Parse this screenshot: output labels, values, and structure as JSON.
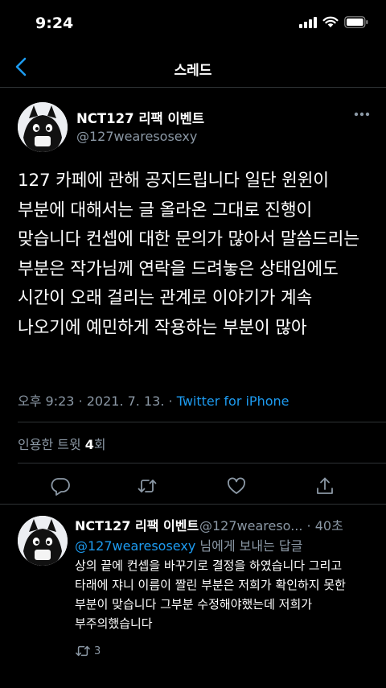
{
  "status": {
    "time": "9:24"
  },
  "nav": {
    "title": "스레드"
  },
  "tweet": {
    "name": "NCT127 리팩 이벤트",
    "handle": "@127wearesosexy",
    "text": "127 카페에 관해 공지드립니다 일단 윈윈이 부분에 대해서는 글 올라온 그대로 진행이 맞습니다 컨셉에 대한 문의가 많아서 말씀드리는 부분은 작가님께 연락을 드려놓은 상태임에도 시간이 오래 걸리는 관계로 이야기가 계속 나오기에 예민하게 작용하는 부분이 많아",
    "time": "오후 9:23",
    "date": "2021. 7. 13.",
    "source": "Twitter for iPhone",
    "quote_label": "인용한 트윗",
    "quote_count": "4",
    "quote_unit": "회"
  },
  "reply": {
    "name": "NCT127 리팩 이벤트",
    "handle": "@127wearesosexy",
    "handle_shown": "@127weareso...",
    "age": "40초",
    "to_handle": "@127wearesosexy",
    "to_suffix": " 님에게 보내는 답글",
    "text": "상의 끝에 컨셉을 바꾸기로 결정을 하였습니다 그리고 타래에 쟈니 이름이 짤린 부분은 저희가 확인하지 못한 부분이 맞습니다 그부분 수정해야했는데 저희가 부주의했습니다",
    "retweet_count": "3"
  },
  "icons": {
    "back": "chevron-left-icon",
    "more": "more-horizontal-icon",
    "reply": "reply-icon",
    "retweet": "retweet-icon",
    "like": "heart-icon",
    "share": "share-icon"
  },
  "colors": {
    "accent": "#1d9bf0",
    "secondary_text": "#8b98a5",
    "divider": "#2f3336",
    "background": "#000000"
  }
}
